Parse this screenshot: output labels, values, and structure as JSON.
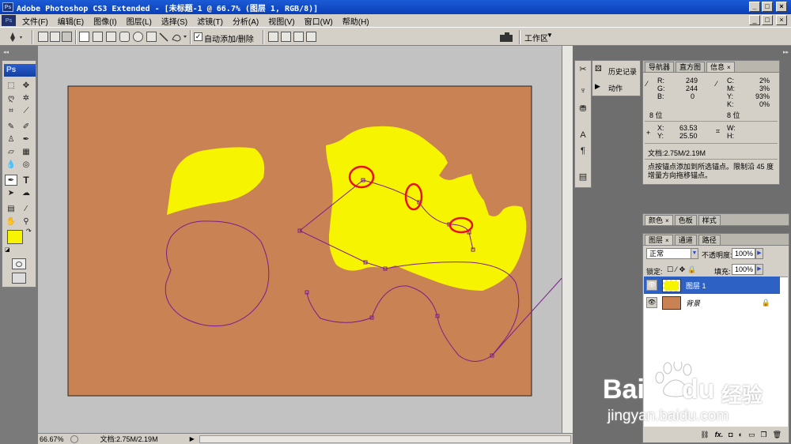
{
  "window": {
    "title": "Adobe Photoshop CS3 Extended - [未标题-1 @ 66.7% (图层 1, RGB/8)]",
    "app_badge": "Ps",
    "minimize": "_",
    "maximize": "□",
    "close": "×"
  },
  "menubar": {
    "items": [
      "文件(F)",
      "编辑(E)",
      "图像(I)",
      "图层(L)",
      "选择(S)",
      "滤镜(T)",
      "分析(A)",
      "视图(V)",
      "窗口(W)",
      "帮助(H)"
    ]
  },
  "options": {
    "auto_add_delete_label": "自动添加/删除",
    "auto_add_delete_checked": true,
    "workspace_label": "工作区"
  },
  "toolbox": {
    "badge": "Ps",
    "foreground_color": "#f7f400",
    "background_color": "#ffffff"
  },
  "canvas": {
    "background_color": "#c98254",
    "shape_color": "#f7f400",
    "path_color": "#7a1e8c",
    "highlight_color": "#e8101a"
  },
  "statusbar": {
    "zoom": "66.67%",
    "doc_info": "文档:2.75M/2.19M"
  },
  "history_panel": {
    "items": [
      "历史记录",
      "动作"
    ]
  },
  "info_panel": {
    "tabs": [
      "导航器",
      "直方图",
      "信息"
    ],
    "rgb": {
      "r_label": "R:",
      "r": "249",
      "g_label": "G:",
      "g": "244",
      "b_label": "B:",
      "b": "0"
    },
    "cmyk": {
      "c_label": "C:",
      "c": "2%",
      "m_label": "M:",
      "m": "3%",
      "y_label": "Y:",
      "y": "93%",
      "k_label": "K:",
      "k": "0%"
    },
    "bits_left": "8 位",
    "bits_right": "8 位",
    "coords": {
      "x_label": "X:",
      "x": "63.53",
      "y_label": "Y:",
      "y": "25.50",
      "w_label": "W:",
      "h_label": "H:"
    },
    "doc_info": "文档:2.75M/2.19M",
    "hint": "点按锚点添加到所选锚点。限制沿 45 度增量方向拖移锚点。"
  },
  "color_panel": {
    "tabs": [
      "颜色",
      "色板",
      "样式"
    ]
  },
  "layers_panel": {
    "tabs": [
      "图层",
      "通道",
      "路径"
    ],
    "blend_mode": "正常",
    "opacity_label": "不透明度:",
    "opacity": "100%",
    "lock_label": "锁定:",
    "fill_label": "填充:",
    "fill": "100%",
    "layers": [
      {
        "name": "图层 1",
        "selected": true
      },
      {
        "name": "背景",
        "selected": false
      }
    ],
    "footer_icons": [
      "link-icon",
      "fx-icon",
      "mask-icon",
      "adjustment-icon",
      "group-icon",
      "new-layer-icon",
      "trash-icon"
    ],
    "fx_label": "fx."
  },
  "watermark": {
    "brand": "Bai",
    "brand2": "du",
    "suffix": "经验",
    "url": "jingyan.baidu.com"
  }
}
